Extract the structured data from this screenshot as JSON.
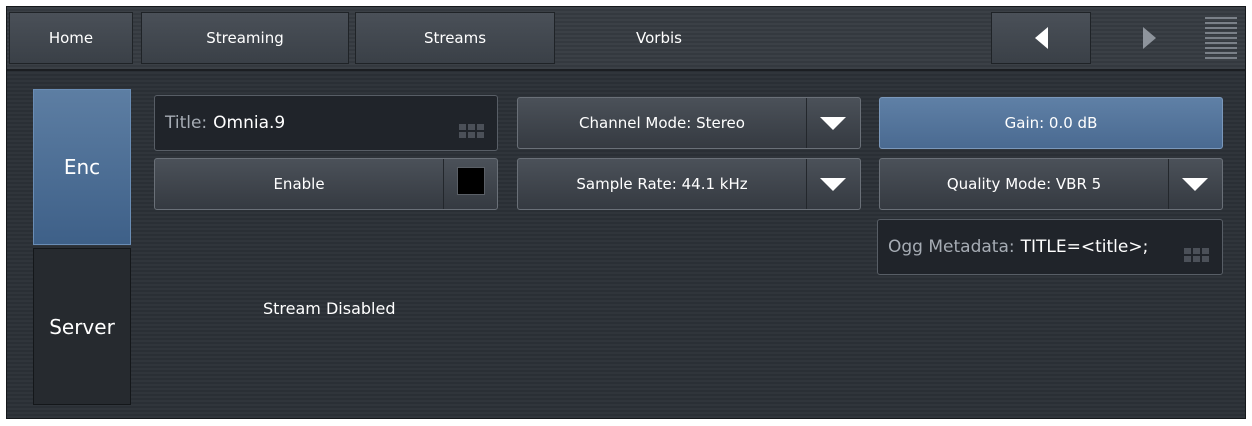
{
  "nav": {
    "home": "Home",
    "streaming": "Streaming",
    "streams": "Streams",
    "current": "Vorbis"
  },
  "icons": {
    "prev": "left-arrow-icon",
    "next": "right-arrow-icon",
    "menu": "menu-icon",
    "dropdown": "triangle-down-icon"
  },
  "side_tabs": {
    "enc": "Enc",
    "server": "Server"
  },
  "encoder": {
    "title_label": "Title:",
    "title_value": "Omnia.9",
    "enable_label": "Enable",
    "enable_checked": false,
    "channel_mode": "Channel Mode: Stereo",
    "sample_rate": "Sample Rate: 44.1 kHz",
    "gain": "Gain: 0.0 dB",
    "quality_mode": "Quality Mode: VBR 5",
    "ogg_label": "Ogg Metadata:",
    "ogg_value": "TITLE=<title>;",
    "status": "Stream Disabled"
  },
  "colors": {
    "background": "#2d3238",
    "active_tab": "#4e6f96",
    "button": "#41474e",
    "text": "#ffffff"
  }
}
